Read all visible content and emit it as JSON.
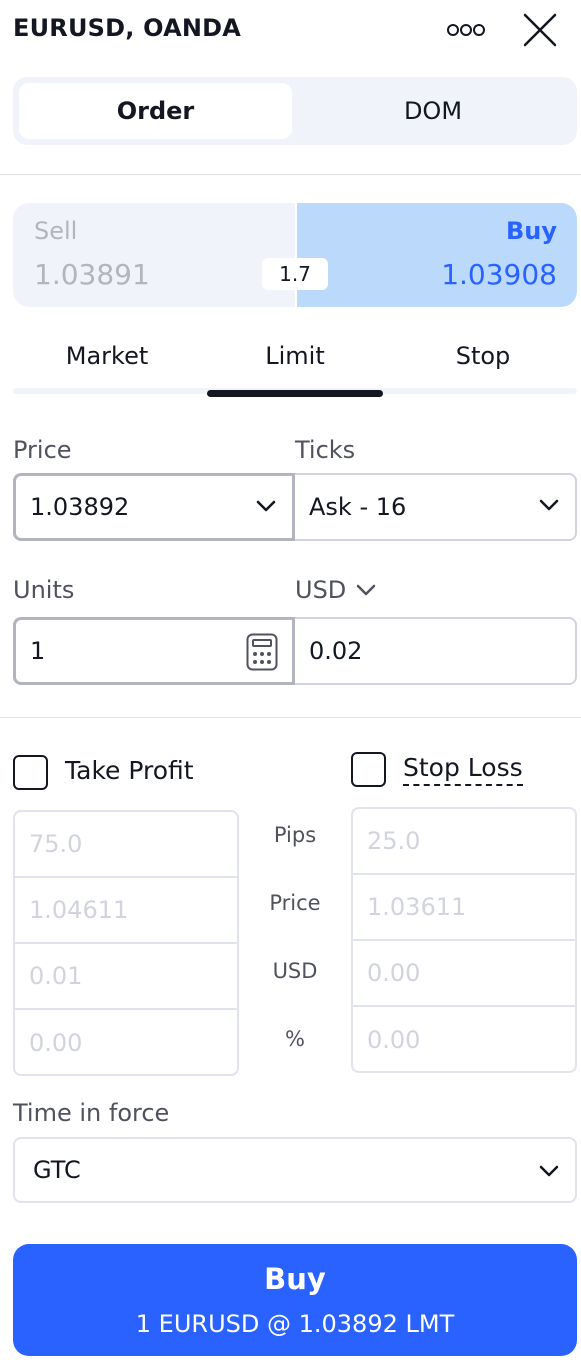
{
  "header": {
    "title": "EURUSD, OANDA",
    "more_icon": "more-horizontal-icon",
    "close_icon": "close-icon"
  },
  "tabs": {
    "order": "Order",
    "dom": "DOM",
    "active": "Order"
  },
  "quote": {
    "sell_label": "Sell",
    "sell_price": "1.03891",
    "spread": "1.7",
    "buy_label": "Buy",
    "buy_price": "1.03908"
  },
  "order_types": {
    "market": "Market",
    "limit": "Limit",
    "stop": "Stop",
    "active": "Limit"
  },
  "price": {
    "label": "Price",
    "value": "1.03892"
  },
  "ticks": {
    "label": "Ticks",
    "value": "Ask - 16"
  },
  "units": {
    "label": "Units",
    "value": "1",
    "calc_icon": "calculator-icon"
  },
  "currency": {
    "label": "USD",
    "value": "0.02"
  },
  "take_profit": {
    "label": "Take Profit",
    "checked": false,
    "pips": "75.0",
    "price": "1.04611",
    "usd": "0.01",
    "percent": "0.00"
  },
  "stop_loss": {
    "label": "Stop Loss",
    "checked": false,
    "pips": "25.0",
    "price": "1.03611",
    "usd": "0.00",
    "percent": "0.00"
  },
  "row_labels": {
    "pips": "Pips",
    "price": "Price",
    "usd": "USD",
    "percent": "%"
  },
  "time_in_force": {
    "label": "Time in force",
    "value": "GTC"
  },
  "submit": {
    "title": "Buy",
    "subtitle": "1 EURUSD @ 1.03892 LMT"
  },
  "colors": {
    "accent": "#2962ff",
    "buy_bg": "#bbd9fb",
    "panel_bg": "#f0f3fa",
    "text": "#131722"
  }
}
